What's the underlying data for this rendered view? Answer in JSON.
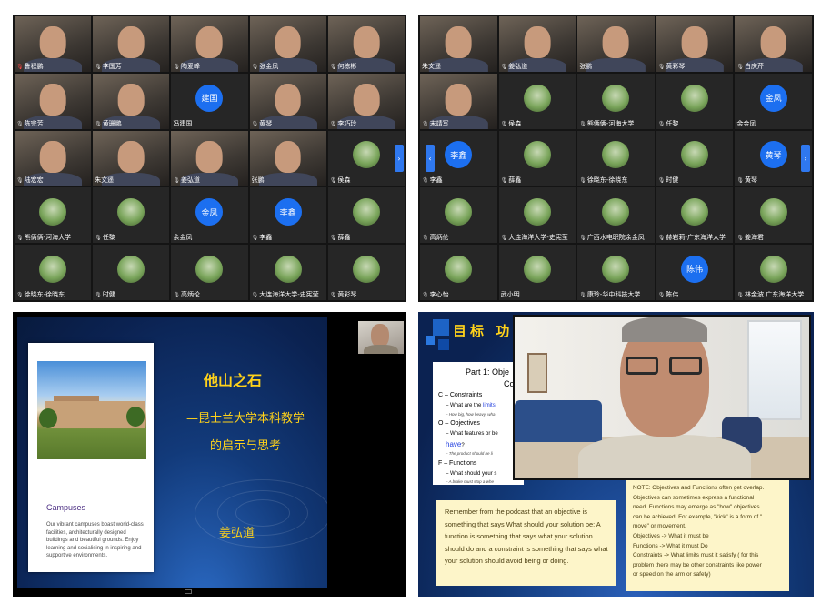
{
  "panel1": {
    "tiles": [
      {
        "type": "cam",
        "name": "鲁程鹏",
        "mic": "red"
      },
      {
        "type": "cam",
        "name": "李国芳",
        "mic": "mute"
      },
      {
        "type": "cam",
        "name": "陶爱峰",
        "mic": "mute"
      },
      {
        "type": "cam",
        "name": "张金凤",
        "mic": "mute"
      },
      {
        "type": "cam",
        "name": "何栋彬",
        "mic": "mute"
      },
      {
        "type": "cam",
        "name": "陈完芳",
        "mic": "mute"
      },
      {
        "type": "cam",
        "name": "黄珊鹏",
        "mic": "mute"
      },
      {
        "type": "avatar",
        "avatar": "建国",
        "name": "冯建国",
        "mic": "none"
      },
      {
        "type": "cam",
        "name": "黄琴",
        "mic": "mute"
      },
      {
        "type": "cam",
        "name": "李巧玲",
        "mic": "mute"
      },
      {
        "type": "cam",
        "name": "陆宏宏",
        "mic": "mute"
      },
      {
        "type": "cam",
        "name": "朱文遥",
        "mic": "none"
      },
      {
        "type": "cam",
        "name": "姜弘道",
        "mic": "mute"
      },
      {
        "type": "cam",
        "name": "张鹏",
        "mic": "none"
      },
      {
        "type": "pic",
        "name": "侯森",
        "mic": "mute"
      },
      {
        "type": "pic",
        "name": "熊俩俩-河海大学",
        "mic": "mute"
      },
      {
        "type": "pic",
        "name": "任黎",
        "mic": "mute"
      },
      {
        "type": "avatar",
        "avatar": "金凤",
        "name": "余金凤",
        "mic": "none"
      },
      {
        "type": "avatar",
        "avatar": "李鑫",
        "name": "李鑫",
        "mic": "mute"
      },
      {
        "type": "pic",
        "name": "薛鑫",
        "mic": "mute"
      },
      {
        "type": "pic",
        "name": "徐晓东-徐晓东",
        "mic": "mute"
      },
      {
        "type": "pic",
        "name": "时健",
        "mic": "mute"
      },
      {
        "type": "pic",
        "name": "高炳伦",
        "mic": "mute"
      },
      {
        "type": "pic",
        "name": "大连海洋大学-史宪莹",
        "mic": "mute"
      },
      {
        "type": "pic",
        "name": "黄彩琴",
        "mic": "mute"
      }
    ],
    "nav_arrow": "›"
  },
  "panel2": {
    "tiles": [
      {
        "type": "cam",
        "name": "朱文遥",
        "mic": "none"
      },
      {
        "type": "cam",
        "name": "姜弘道",
        "mic": "mute"
      },
      {
        "type": "cam",
        "name": "张鹏",
        "mic": "none"
      },
      {
        "type": "cam",
        "name": "黄彩琴",
        "mic": "mute"
      },
      {
        "type": "cam",
        "name": "白庆芹",
        "mic": "mute"
      },
      {
        "type": "cam",
        "name": "末靖写",
        "mic": "mute"
      },
      {
        "type": "pic",
        "name": "侯森",
        "mic": "mute"
      },
      {
        "type": "pic",
        "name": "熊俩俩-河海大学",
        "mic": "mute"
      },
      {
        "type": "pic",
        "name": "任黎",
        "mic": "mute"
      },
      {
        "type": "avatar",
        "avatar": "金凤",
        "name": "余金凤",
        "mic": "none"
      },
      {
        "type": "avatar",
        "avatar": "李鑫",
        "name": "李鑫",
        "mic": "mute"
      },
      {
        "type": "pic",
        "name": "薛鑫",
        "mic": "mute"
      },
      {
        "type": "pic",
        "name": "徐晓东-徐晓东",
        "mic": "mute"
      },
      {
        "type": "pic",
        "name": "时健",
        "mic": "mute"
      },
      {
        "type": "avatar",
        "avatar": "黄琴",
        "name": "黄琴",
        "mic": "mute"
      },
      {
        "type": "pic",
        "name": "高炳伦",
        "mic": "mute"
      },
      {
        "type": "pic",
        "name": "大连海洋大学-史宪莹",
        "mic": "mute"
      },
      {
        "type": "pic",
        "name": "广西水电职院余金凤",
        "mic": "mute"
      },
      {
        "type": "pic",
        "name": "赫岩莉-广东海洋大学",
        "mic": "mute"
      },
      {
        "type": "pic",
        "name": "姜海君",
        "mic": "mute"
      },
      {
        "type": "pic",
        "name": "李心怡",
        "mic": "mute"
      },
      {
        "type": "pic",
        "name": "武小明",
        "mic": "none"
      },
      {
        "type": "pic",
        "name": "康玲-华中科技大学",
        "mic": "mute"
      },
      {
        "type": "avatar",
        "avatar": "陈伟",
        "name": "陈伟",
        "mic": "mute"
      },
      {
        "type": "pic",
        "name": "林金波 广东海洋大学",
        "mic": "mute"
      }
    ],
    "nav_left": "‹",
    "nav_right": "›"
  },
  "panel3": {
    "card_title": "Campuses",
    "card_text": "Our vibrant campuses boast world-class facilities, architecturally designed buildings and beautiful grounds. Enjoy learning and socialising in inspiring and supportive environments.",
    "title_main": "他山之石",
    "title_line2": "—昆士兰大学本科教学",
    "title_line3": "的启示与思考",
    "presenter": "姜弘道"
  },
  "panel4": {
    "header": "目标  功",
    "part_title_a": "Part 1: Obje",
    "part_title_b": "Co",
    "c_label": "C – Constraints",
    "c_q_a": "– What are the ",
    "c_q_b": "limits",
    "c_tiny": "– How big, how heavy, wha",
    "o_label": "O – Objectives",
    "o_q_a": "– What features or be",
    "o_q_b": "have",
    "o_q_c": "?",
    "o_tiny": "– The product should be li",
    "f_label": "F – Functions",
    "f_q": "– What should your s",
    "f_tiny": "– A brake must stop a whe",
    "podcast_text": "Remember from the podcast that an objective is something that says What should your solution be: A function is something that says what your solution should do and a constraint is something that says what your solution should avoid being or doing.",
    "note_lines": [
      "NOTE: Objectives and Functions often get overlap.",
      "Objectives can sometimes express a functional",
      "need. Functions may emerge as \"how\" objectives",
      "can be achieved. For example, \"kick\" is a form of \"",
      "move\" or movement.",
      "Objectives -> What it must be",
      "Functions -> What it must Do",
      "Constraints -> What limits must it satisfy ( for this",
      "problem there may be other constraints like power",
      "or speed on the arm or safety)"
    ]
  }
}
